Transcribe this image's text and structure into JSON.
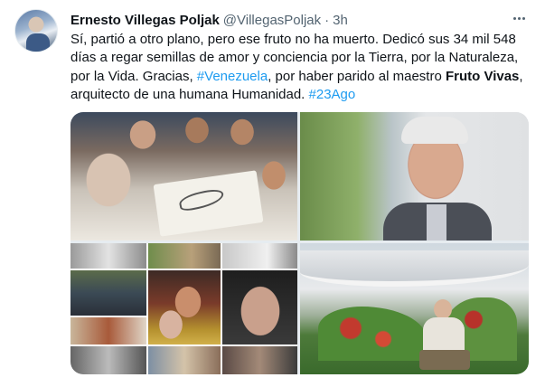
{
  "tweet": {
    "author_name": "Ernesto Villegas Poljak",
    "author_handle": "@VillegasPoljak",
    "separator": "·",
    "time": "3h",
    "text_part1": "Sí, partió a otro plano, pero ese fruto no ha muerto. Dedicó sus 34 mil 548 días a regar semillas de amor y conciencia por la Tierra, por la Naturaleza, por la Vida. Gracias, ",
    "hashtag1": "#Venezuela",
    "text_part2": ", por haber parido al maestro ",
    "bold_name": "Fruto Vivas",
    "text_part3": ", arquitecto de una humana Humanidad. ",
    "hashtag2": "#23Ago"
  },
  "icons": {
    "more": "more-horizontal-icon"
  },
  "colors": {
    "link": "#1d9bf0",
    "text": "#0f1419",
    "muted": "#536471"
  }
}
